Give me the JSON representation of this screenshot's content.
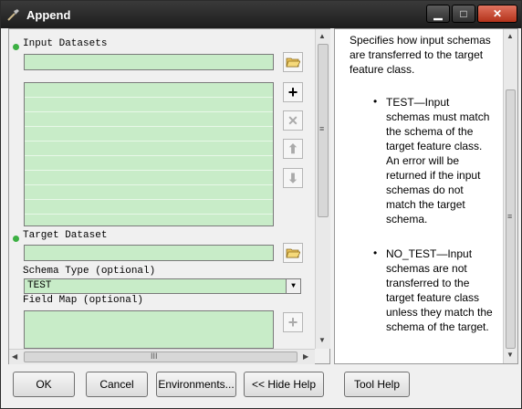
{
  "window": {
    "title": "Append",
    "controls": {
      "minimize": "▁",
      "maximize": "□",
      "close": "✕"
    }
  },
  "form": {
    "input_datasets_label": "Input Datasets",
    "input_datasets_value": "",
    "target_dataset_label": "Target Dataset",
    "target_dataset_value": "",
    "schema_type_label": "Schema Type (optional)",
    "schema_type_value": "TEST",
    "field_map_label": "Field Map (optional)",
    "icons": {
      "browse": "folder-open-icon",
      "add": "plus-icon",
      "remove": "x-icon",
      "up": "arrow-up-icon",
      "down": "arrow-down-icon"
    },
    "glyphs": {
      "add": "+",
      "remove": "✕",
      "up": "⬆",
      "down": "⬇",
      "dropdown": "▼"
    }
  },
  "scroll": {
    "grip": "≡",
    "hgrip": "III",
    "up": "▲",
    "down": "▼",
    "left": "◀",
    "right": "▶"
  },
  "help": {
    "intro": "Specifies how input schemas are transferred to the target feature class.",
    "items": [
      {
        "text": "TEST—Input schemas must match the schema of the target feature class. An error will be returned if the input schemas do not match the target schema."
      },
      {
        "text": "NO_TEST—Input schemas are not transferred to the target feature class unless they match the schema of the target."
      }
    ],
    "bullet": "•"
  },
  "buttons": {
    "ok": "OK",
    "cancel": "Cancel",
    "environments": "Environments...",
    "hide_help": "<< Hide Help",
    "tool_help": "Tool Help"
  },
  "colors": {
    "field_bg": "#c8ecc8",
    "required_dot": "#3cb043",
    "titlebar": "#1d1d1d",
    "close_button": "#b3321a"
  }
}
